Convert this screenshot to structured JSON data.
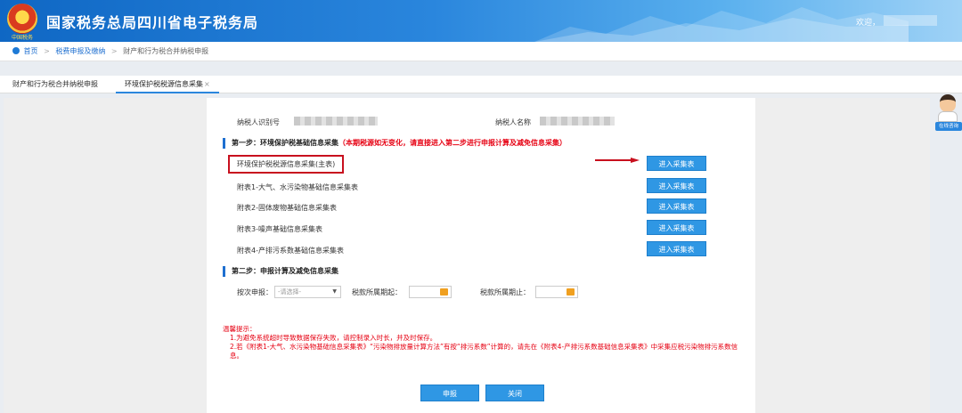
{
  "header": {
    "title": "国家税务总局四川省电子税务局",
    "emblem_text": "中国税务",
    "welcome": "欢迎，"
  },
  "breadcrumb": {
    "home": "首页",
    "level1": "税费申报及缴纳",
    "level2": "财产和行为税合并纳税申报"
  },
  "tabs": [
    {
      "label": "财产和行为税合并纳税申报"
    },
    {
      "label": "环境保护税税源信息采集",
      "close": "×"
    }
  ],
  "taxpayer": {
    "id_label": "纳税人识别号",
    "name_label": "纳税人名称"
  },
  "step1": {
    "title": "第一步：环境保护税基础信息采集",
    "note": "（本期税源如无变化，请直接进入第二步进行申报计算及减免信息采集）",
    "rows": [
      {
        "label": "环境保护税税源信息采集(主表)",
        "button": "进入采集表"
      },
      {
        "label": "附表1-大气、水污染物基础信息采集表",
        "button": "进入采集表"
      },
      {
        "label": "附表2-固体废物基础信息采集表",
        "button": "进入采集表"
      },
      {
        "label": "附表3-噪声基础信息采集表",
        "button": "进入采集表"
      },
      {
        "label": "附表4-产排污系数基础信息采集表",
        "button": "进入采集表"
      }
    ]
  },
  "step2": {
    "title": "第二步：申报计算及减免信息采集",
    "period_label": "按次申报：",
    "period_placeholder": "-请选择-",
    "start_label": "税款所属期起：",
    "end_label": "税款所属期止："
  },
  "tips": {
    "title": "温馨提示：",
    "line1": "1.为避免系统超时导致数据保存失败，请控制录入时长，并及时保存。",
    "line2": "2.若《附表1-大气、水污染物基础信息采集表》“污染物排放量计算方法”有按“排污系数”计算的，请先在《附表4-产排污系数基础信息采集表》中采集应税污染物排污系数信息。"
  },
  "actions": {
    "declare": "申报",
    "close": "关闭"
  },
  "service": {
    "label": "在线咨询"
  },
  "colors": {
    "header_blue": "#1e6fd0",
    "button_blue": "#2f97e4",
    "warning_red": "#e60012"
  }
}
